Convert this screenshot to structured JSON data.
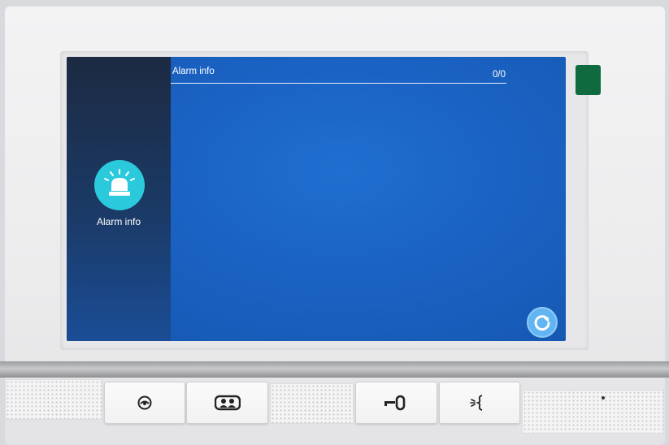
{
  "screen": {
    "side_panel": {
      "icon": "alarm-siren-icon",
      "label": "Alarm info"
    },
    "header": {
      "title": "Alarm info",
      "count": "0/0"
    },
    "refresh_icon": "refresh-icon"
  },
  "hardware_keys": [
    {
      "name": "monitor-key",
      "icon": "eye-icon"
    },
    {
      "name": "intercom-key",
      "icon": "two-people-icon"
    },
    {
      "name": "unlock-key",
      "icon": "key-icon"
    },
    {
      "name": "talk-key",
      "icon": "voice-icon"
    }
  ],
  "colors": {
    "screen_blue": "#1a62c3",
    "side_panel_dark": "#1c2a42",
    "alarm_icon_bg": "#2bc9dc",
    "refresh_button_bg": "#62b5f2",
    "status_led": "#0f6b3f"
  }
}
